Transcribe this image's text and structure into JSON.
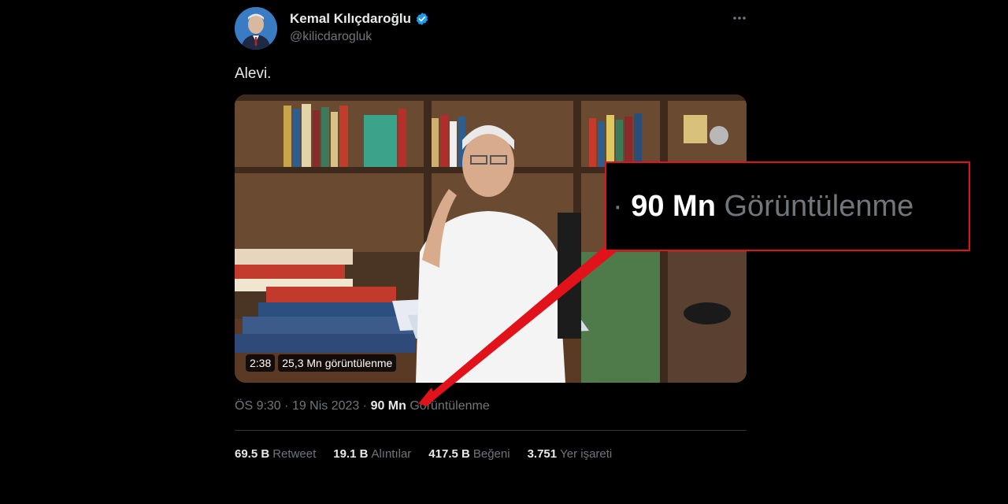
{
  "tweet": {
    "author_name": "Kemal Kılıçdaroğlu",
    "handle": "@kilicdarogluk",
    "text": "Alevi.",
    "more_icon": "more-horizontal-icon",
    "verified_icon": "verified-badge-icon",
    "video": {
      "duration": "2:38",
      "views_overlay": "25,3 Mn görüntülenme"
    },
    "meta": {
      "time": "ÖS 9:30",
      "separator": "·",
      "date": "19 Nis 2023",
      "views_count": "90 Mn",
      "views_label": "Görüntülenme"
    },
    "stats": [
      {
        "value": "69.5 B",
        "label": "Retweet"
      },
      {
        "value": "19.1 B",
        "label": "Alıntılar"
      },
      {
        "value": "417.5 B",
        "label": "Beğeni"
      },
      {
        "value": "3.751",
        "label": "Yer işareti"
      }
    ]
  },
  "callout": {
    "separator": "·",
    "views_count": "90 Mn",
    "views_label": "Görüntülenme",
    "border_color": "#e1121a"
  },
  "colors": {
    "background": "#000000",
    "text_primary": "#e7e9ea",
    "text_secondary": "#71767b",
    "verified": "#1d9bf0",
    "highlight": "#e1121a"
  }
}
